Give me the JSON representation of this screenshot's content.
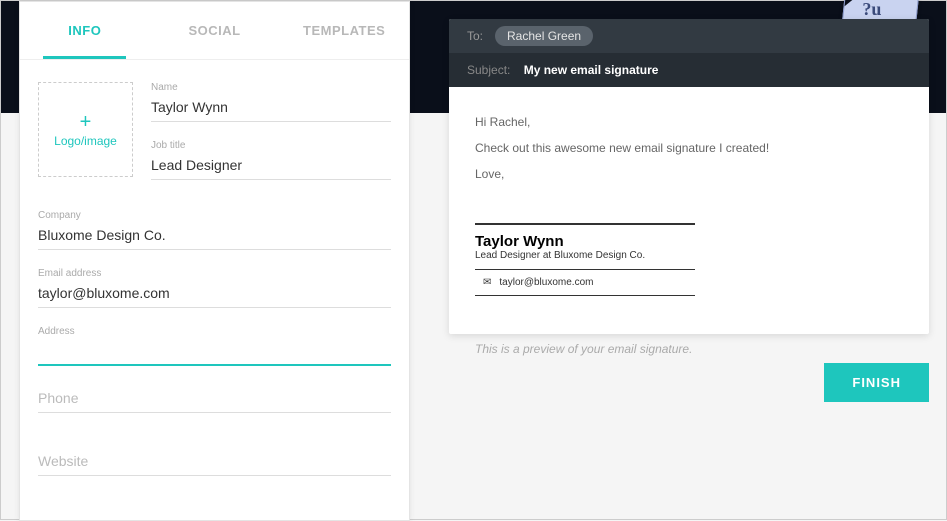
{
  "tabs": {
    "info": "INFO",
    "social": "SOCIAL",
    "templates": "TEMPLATES"
  },
  "logoUpload": {
    "label": "Logo/image"
  },
  "form": {
    "name": {
      "label": "Name",
      "value": "Taylor Wynn"
    },
    "jobTitle": {
      "label": "Job title",
      "value": "Lead Designer"
    },
    "company": {
      "label": "Company",
      "value": "Bluxome Design Co."
    },
    "email": {
      "label": "Email address",
      "value": "taylor@bluxome.com"
    },
    "address": {
      "label": "Address",
      "value": ""
    },
    "phone": {
      "placeholder": "Phone",
      "value": ""
    },
    "website": {
      "placeholder": "Website",
      "value": ""
    }
  },
  "email": {
    "toLabel": "To:",
    "recipient": "Rachel Green",
    "subjectLabel": "Subject:",
    "subject": "My new email signature",
    "body": {
      "line1": "Hi Rachel,",
      "line2": "Check out this awesome new email signature I created!",
      "line3": "Love,"
    }
  },
  "signature": {
    "name": "Taylor Wynn",
    "title": "Lead Designer at Bluxome Design Co.",
    "email": "taylor@bluxome.com"
  },
  "previewNote": "This is a preview of your email signature.",
  "finishButton": "FINISH"
}
